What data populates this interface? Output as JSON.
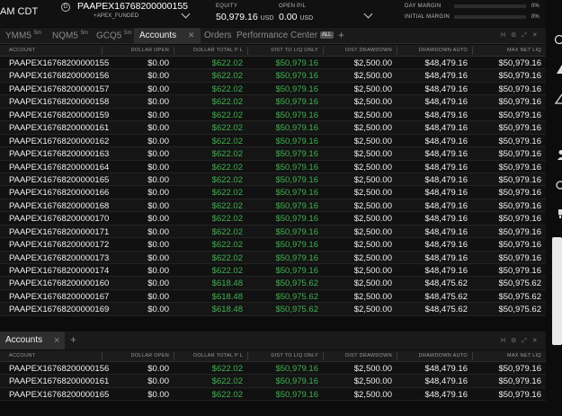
{
  "header": {
    "time": "AM CDT",
    "account_icon": "D",
    "account_name": "PAAPEX16768200000155",
    "account_sub": "+APEX_FUNDED",
    "equity_label": "EQUITY",
    "equity_value": "50,979.16",
    "equity_unit": "USD",
    "openpl_label": "OPEN P/L",
    "openpl_value": "0.00",
    "openpl_unit": "USD",
    "day_margin_label": "DAY MARGIN",
    "day_margin_pct": "0%",
    "initial_margin_label": "INITIAL MARGIN",
    "initial_margin_pct": "0%"
  },
  "tabs": {
    "t1": "YMM5",
    "t1_sup": "5m",
    "t2": "NQM5",
    "t2_sup": "5m",
    "t3": "GCQ5",
    "t3_sup": "5m",
    "t4": "Accounts",
    "t5": "Orders",
    "t6": "Performance Center",
    "t6_badge": "ALL",
    "plus": "+",
    "controls": "H ⚙ ⤢ ✕"
  },
  "columns": {
    "account": "ACCOUNT",
    "dollar_open": "DOLLAR OPEN",
    "dollar_total": "DOLLAR TOTAL P L",
    "dist_liq": "DIST TO LIQ ONLY",
    "dist_dd": "DIST DRAWDOWN",
    "dd_auto": "DRAWDOWN AUTO",
    "max_net": "MAX NET LIQ"
  },
  "rows": [
    [
      "PAAPEX16768200000155",
      "$0.00",
      "$622.02",
      "$50,979.16",
      "$2,500.00",
      "$48,479.16",
      "$50,979.16"
    ],
    [
      "PAAPEX16768200000156",
      "$0.00",
      "$622.02",
      "$50,979.16",
      "$2,500.00",
      "$48,479.16",
      "$50,979.16"
    ],
    [
      "PAAPEX16768200000157",
      "$0.00",
      "$622.02",
      "$50,979.16",
      "$2,500.00",
      "$48,479.16",
      "$50,979.16"
    ],
    [
      "PAAPEX16768200000158",
      "$0.00",
      "$622.02",
      "$50,979.16",
      "$2,500.00",
      "$48,479.16",
      "$50,979.16"
    ],
    [
      "PAAPEX16768200000159",
      "$0.00",
      "$622.02",
      "$50,979.16",
      "$2,500.00",
      "$48,479.16",
      "$50,979.16"
    ],
    [
      "PAAPEX16768200000161",
      "$0.00",
      "$622.02",
      "$50,979.16",
      "$2,500.00",
      "$48,479.16",
      "$50,979.16"
    ],
    [
      "PAAPEX16768200000162",
      "$0.00",
      "$622.02",
      "$50,979.16",
      "$2,500.00",
      "$48,479.16",
      "$50,979.16"
    ],
    [
      "PAAPEX16768200000163",
      "$0.00",
      "$622.02",
      "$50,979.16",
      "$2,500.00",
      "$48,479.16",
      "$50,979.16"
    ],
    [
      "PAAPEX16768200000164",
      "$0.00",
      "$622.02",
      "$50,979.16",
      "$2,500.00",
      "$48,479.16",
      "$50,979.16"
    ],
    [
      "PAAPEX16768200000165",
      "$0.00",
      "$622.02",
      "$50,979.16",
      "$2,500.00",
      "$48,479.16",
      "$50,979.16"
    ],
    [
      "PAAPEX16768200000166",
      "$0.00",
      "$622.02",
      "$50,979.16",
      "$2,500.00",
      "$48,479.16",
      "$50,979.16"
    ],
    [
      "PAAPEX16768200000168",
      "$0.00",
      "$622.02",
      "$50,979.16",
      "$2,500.00",
      "$48,479.16",
      "$50,979.16"
    ],
    [
      "PAAPEX16768200000170",
      "$0.00",
      "$622.02",
      "$50,979.16",
      "$2,500.00",
      "$48,479.16",
      "$50,979.16"
    ],
    [
      "PAAPEX16768200000171",
      "$0.00",
      "$622.02",
      "$50,979.16",
      "$2,500.00",
      "$48,479.16",
      "$50,979.16"
    ],
    [
      "PAAPEX16768200000172",
      "$0.00",
      "$622.02",
      "$50,979.16",
      "$2,500.00",
      "$48,479.16",
      "$50,979.16"
    ],
    [
      "PAAPEX16768200000173",
      "$0.00",
      "$622.02",
      "$50,979.16",
      "$2,500.00",
      "$48,479.16",
      "$50,979.16"
    ],
    [
      "PAAPEX16768200000174",
      "$0.00",
      "$622.02",
      "$50,979.16",
      "$2,500.00",
      "$48,479.16",
      "$50,979.16"
    ],
    [
      "PAAPEX16768200000160",
      "$0.00",
      "$618.48",
      "$50,975.62",
      "$2,500.00",
      "$48,475.62",
      "$50,975.62"
    ],
    [
      "PAAPEX16768200000167",
      "$0.00",
      "$618.48",
      "$50,975.62",
      "$2,500.00",
      "$48,475.62",
      "$50,975.62"
    ],
    [
      "PAAPEX16768200000169",
      "$0.00",
      "$618.48",
      "$50,975.62",
      "$2,500.00",
      "$48,475.62",
      "$50,975.62"
    ]
  ],
  "panel2": {
    "tab": "Accounts",
    "close": "×",
    "plus": "+",
    "controls": "H ⚙ ⤢ ✕",
    "rows": [
      [
        "PAAPEX16768200000156",
        "$0.00",
        "$622.02",
        "$50,979.16",
        "$2,500.00",
        "$48,479.16",
        "$50,979.16"
      ],
      [
        "PAAPEX16768200000161",
        "$0.00",
        "$622.02",
        "$50,979.16",
        "$2,500.00",
        "$48,479.16",
        "$50,979.16"
      ],
      [
        "PAAPEX16768200000165",
        "$0.00",
        "$622.02",
        "$50,979.16",
        "$2,500.00",
        "$48,479.16",
        "$50,979.16"
      ]
    ]
  },
  "colors": {
    "positive": "#3fb24f",
    "background": "#0c0c0c"
  }
}
